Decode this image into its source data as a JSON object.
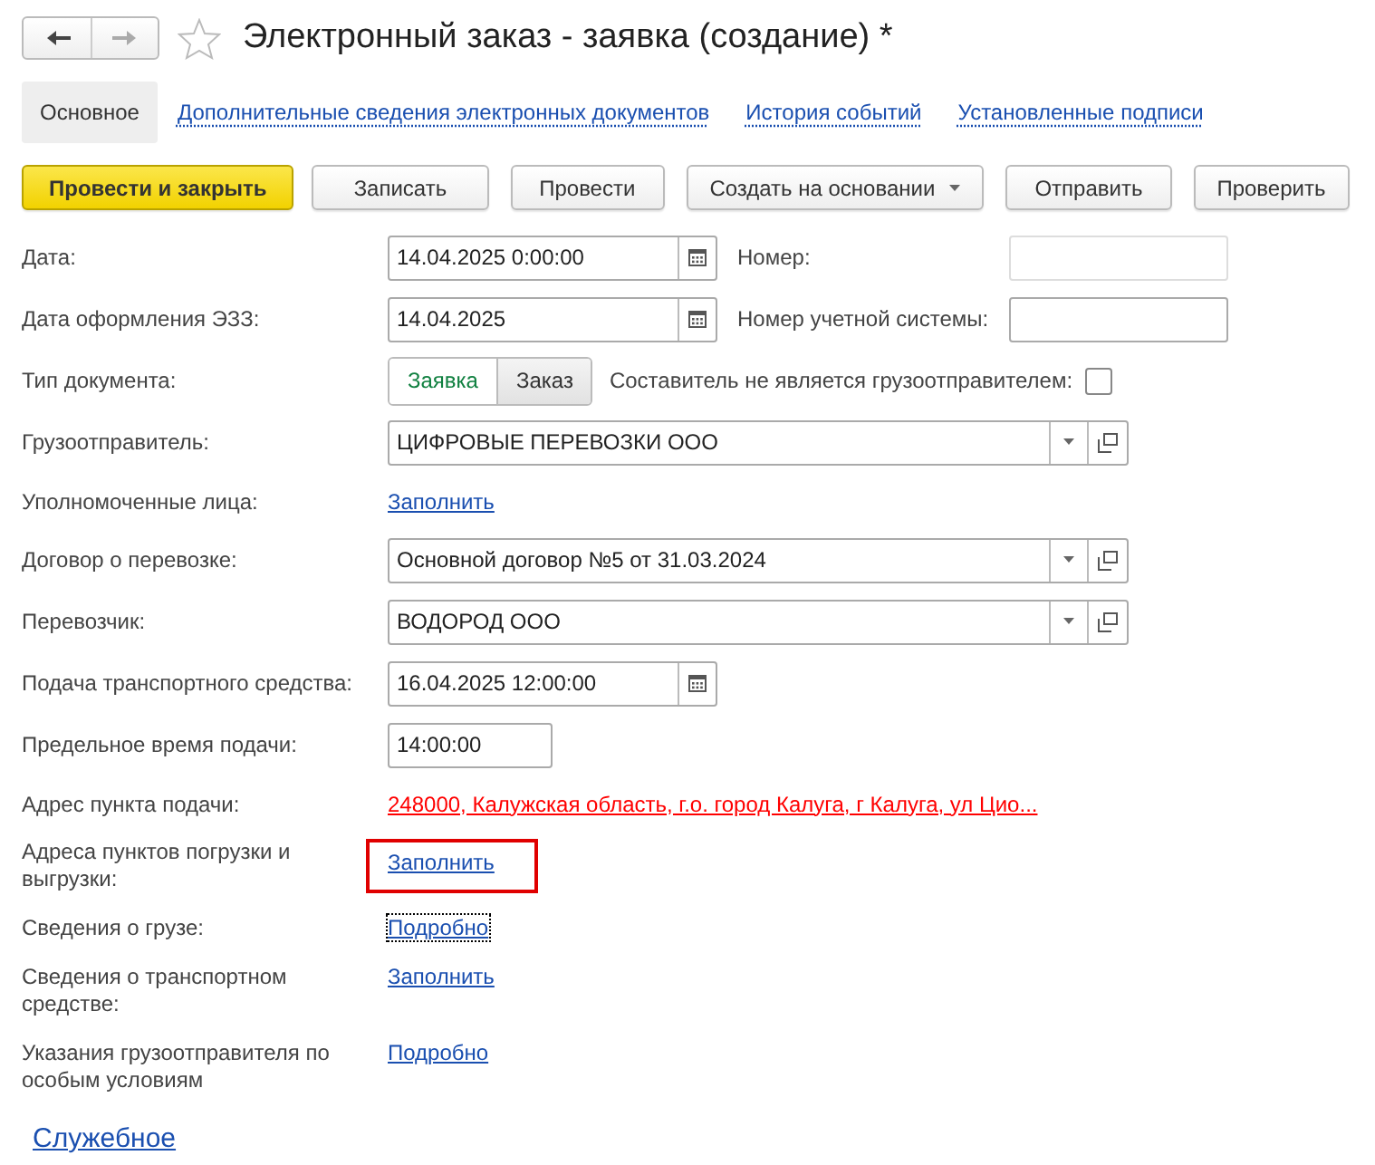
{
  "nav": {
    "back_enabled": true,
    "forward_enabled": false
  },
  "title": "Электронный заказ - заявка (создание) *",
  "favorite": false,
  "tabs": [
    {
      "label": "Основное",
      "selected": true
    },
    {
      "label": "Дополнительные сведения электронных документов",
      "selected": false
    },
    {
      "label": "История событий",
      "selected": false
    },
    {
      "label": "Установленные подписи",
      "selected": false
    }
  ],
  "toolbar": [
    {
      "label": "Провести и закрыть",
      "kind": "primary"
    },
    {
      "label": "Записать",
      "kind": "plain"
    },
    {
      "label": "Провести",
      "kind": "plain"
    },
    {
      "label": "Создать на основании",
      "kind": "menu"
    },
    {
      "label": "Отправить",
      "kind": "plain"
    },
    {
      "label": "Проверить",
      "kind": "plain"
    }
  ],
  "fields": [
    {
      "label": "Дата:",
      "kind": "date",
      "value": "14.04.2025  0:00:00",
      "side": {
        "kind": "input",
        "label": "Номер:",
        "disabled": true
      }
    },
    {
      "label": "Дата оформления ЭЗЗ:",
      "kind": "date",
      "value": "14.04.2025",
      "side": {
        "kind": "input",
        "label": "Номер учетной системы:",
        "disabled": false
      }
    },
    {
      "label": "Тип документа:",
      "kind": "switch",
      "options": [
        {
          "label": "Заявка",
          "selected": true
        },
        {
          "label": "Заказ",
          "selected": false
        }
      ],
      "side": {
        "kind": "checkbox",
        "label": "Составитель не является грузоотправителем:",
        "checked": false
      }
    },
    {
      "label": "Грузоотправитель:",
      "kind": "ref",
      "value": "ЦИФРОВЫЕ ПЕРЕВОЗКИ ООО"
    },
    {
      "label": "Уполномоченные лица:",
      "kind": "link",
      "value": "Заполнить",
      "error": false,
      "focused": false,
      "highlighted": false
    },
    {
      "label": "Договор о перевозке:",
      "kind": "ref",
      "value": "Основной договор №5 от 31.03.2024"
    },
    {
      "label": "Перевозчик:",
      "kind": "ref",
      "value": "ВОДОРОД ООО"
    },
    {
      "label": "Подача транспортного средства:",
      "kind": "date",
      "value": "16.04.2025 12:00:00"
    },
    {
      "label": "Предельное время подачи:",
      "kind": "time",
      "value": "14:00:00"
    },
    {
      "label": "Адрес пункта подачи:",
      "kind": "link",
      "value": "248000, Калужская область, г.о. город Калуга, г Калуга, ул Цио...",
      "error": true,
      "focused": false,
      "highlighted": false
    },
    {
      "label": "Адреса пунктов погрузки и выгрузки:",
      "kind": "link",
      "value": "Заполнить",
      "error": false,
      "focused": false,
      "highlighted": true
    },
    {
      "label": "Сведения о грузе:",
      "kind": "link",
      "value": "Подробно",
      "error": false,
      "focused": true,
      "highlighted": false
    },
    {
      "label": "Сведения о транспортном средстве:",
      "kind": "link",
      "value": "Заполнить",
      "error": false,
      "focused": false,
      "highlighted": false
    },
    {
      "label": "Указания грузоотправителя по особым условиям",
      "kind": "link",
      "value": "Подробно",
      "error": false,
      "focused": false,
      "highlighted": false
    }
  ],
  "footer_link": "Служебное"
}
